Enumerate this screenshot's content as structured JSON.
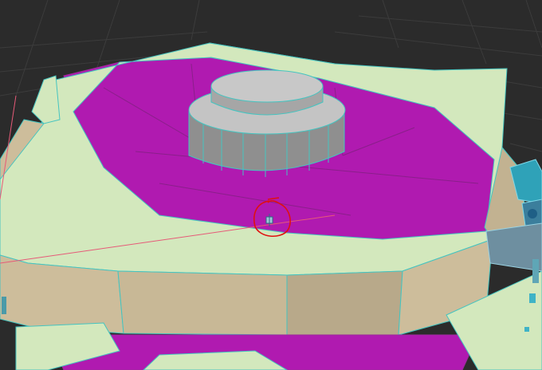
{
  "viewport": {
    "type": "3d-perspective-viewport",
    "background_color": "#2b2b2b",
    "grid_color": "#3a3a3a",
    "wireframe_edge_color": "#45c4c0"
  },
  "scene": {
    "objects": [
      {
        "name": "star-platform",
        "top_color": "#d3e8bd",
        "side_color": "#cdbd9b",
        "side_shadow_color": "#b8a98a"
      },
      {
        "name": "magenta-floor",
        "color": "#b01ab0"
      },
      {
        "name": "center-cylinder",
        "top_color": "#c4c4c4",
        "side_color": "#8f8f8f"
      },
      {
        "name": "teal-objects",
        "color": "#2fa2b8"
      }
    ],
    "annotation": {
      "type": "hand-drawn-circle",
      "color": "#e01010"
    },
    "selection_line_color": "#e65a78"
  }
}
